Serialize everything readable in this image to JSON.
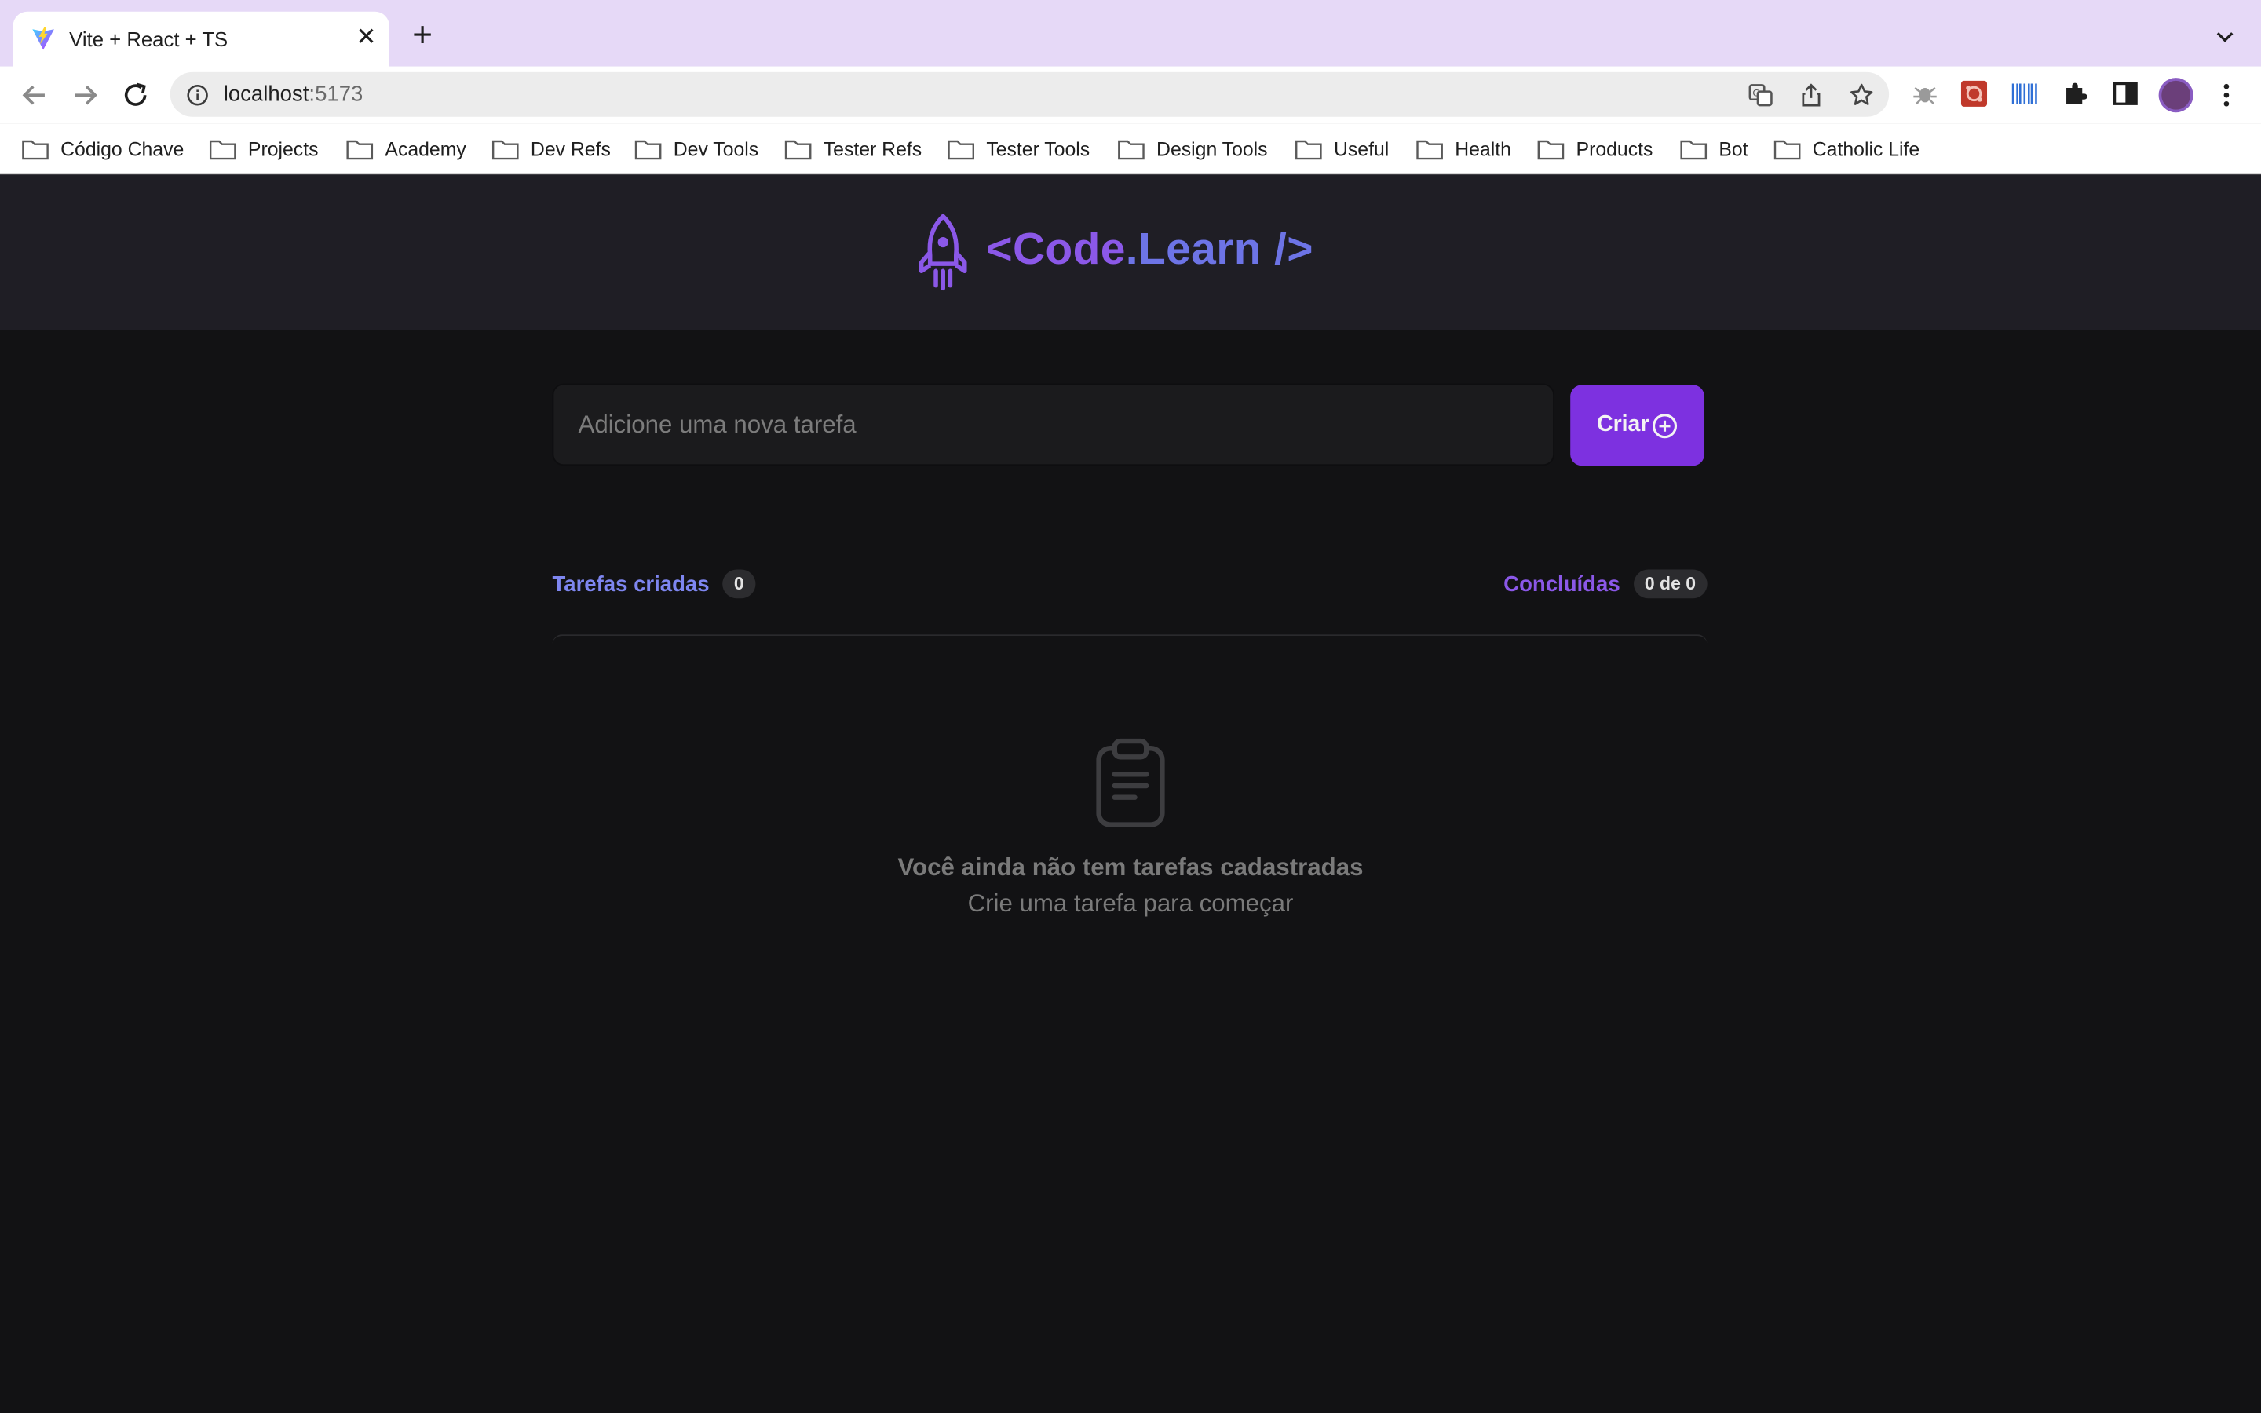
{
  "browser": {
    "tab": {
      "title": "Vite + React + TS"
    },
    "omnibox": {
      "host": "localhost",
      "port": ":5173"
    },
    "bookmarks": [
      "Código Chave",
      "Projects",
      "Academy",
      "Dev Refs",
      "Dev Tools",
      "Tester Refs",
      "Tester Tools",
      "Design Tools",
      "Useful",
      "Health",
      "Products",
      "Bot",
      "Catholic Life"
    ]
  },
  "app": {
    "logo": {
      "prefix": "<Code",
      "dot": ".",
      "suffix": "Learn />"
    },
    "input": {
      "placeholder": "Adicione uma nova tarefa",
      "value": ""
    },
    "create_button": {
      "label": "Criar"
    },
    "counters": {
      "created": {
        "label": "Tarefas criadas",
        "value": "0"
      },
      "done": {
        "label": "Concluídas",
        "value": "0 de 0"
      }
    },
    "empty": {
      "title": "Você ainda não tem tarefas cadastradas",
      "subtitle": "Crie uma tarefa para começar"
    },
    "colors": {
      "purple": "#8b58e8",
      "blue": "#7e86f0",
      "button": "#7d31e0",
      "background": "#121214",
      "header": "#1f1e25"
    }
  }
}
